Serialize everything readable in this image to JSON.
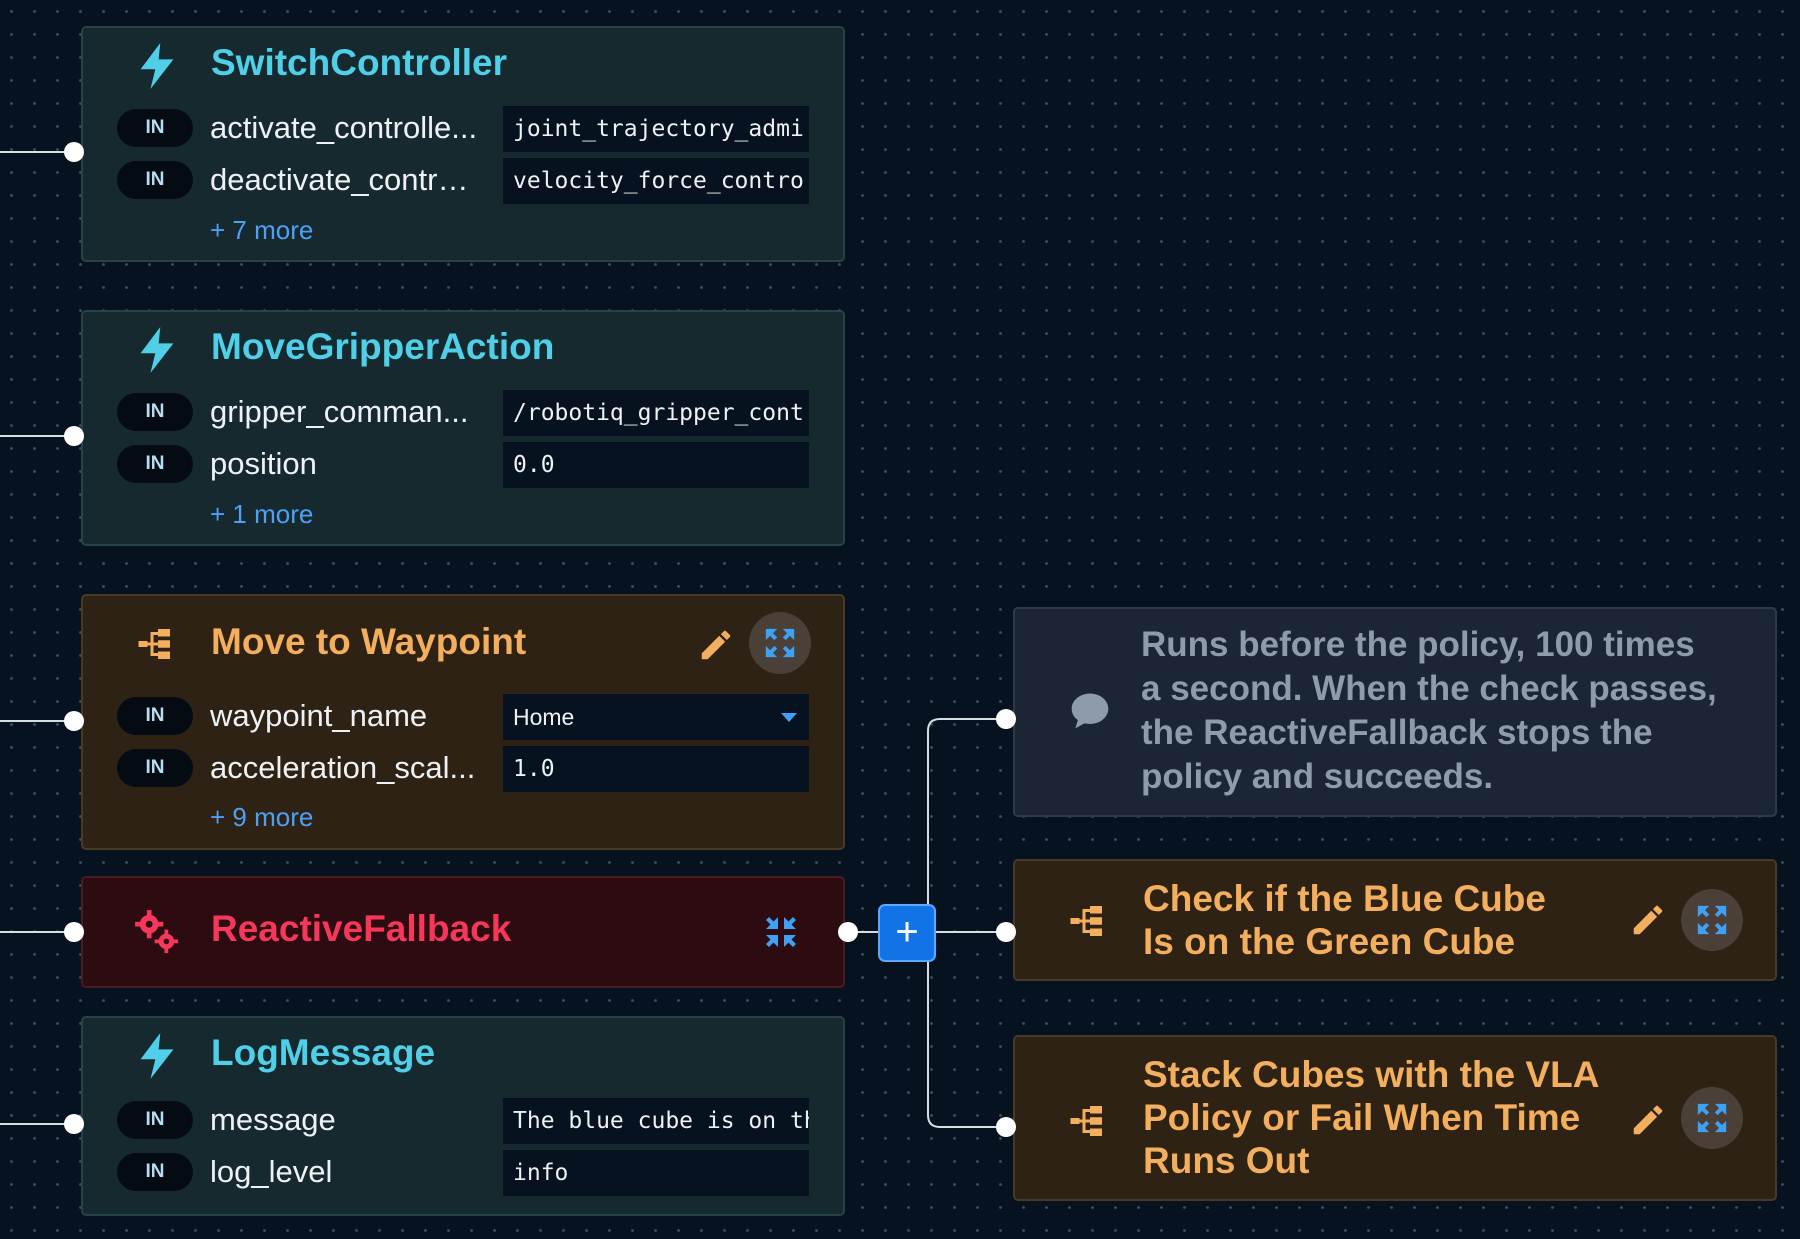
{
  "colors": {
    "canvas_bg": "#06121f",
    "action_title": "#4fd0e8",
    "subtree_title": "#f3ae5e",
    "control_title": "#f6375a",
    "link": "#4fa0f5",
    "add_button": "#1273e6"
  },
  "nodes": {
    "switch_controller": {
      "icon": "lightning-icon",
      "title": "SwitchController",
      "ports": [
        {
          "badge": "IN",
          "label": "activate_controlle...",
          "value": "joint_trajectory_admi"
        },
        {
          "badge": "IN",
          "label": "deactivate_contro...",
          "value": "velocity_force_contro"
        }
      ],
      "more": "+ 7 more"
    },
    "move_gripper_action": {
      "icon": "lightning-icon",
      "title": "MoveGripperAction",
      "ports": [
        {
          "badge": "IN",
          "label": "gripper_comman...",
          "value": "/robotiq_gripper_cont"
        },
        {
          "badge": "IN",
          "label": "position",
          "value": "0.0"
        }
      ],
      "more": "+ 1 more"
    },
    "move_to_waypoint": {
      "icon": "subtree-icon",
      "title": "Move to Waypoint",
      "ports": [
        {
          "badge": "IN",
          "label": "waypoint_name",
          "value": "Home",
          "dropdown": true
        },
        {
          "badge": "IN",
          "label": "acceleration_scal...",
          "value": "1.0"
        }
      ],
      "more": "+ 9 more"
    },
    "reactive_fallback": {
      "icon": "gears-icon",
      "title": "ReactiveFallback"
    },
    "log_message": {
      "icon": "lightning-icon",
      "title": "LogMessage",
      "ports": [
        {
          "badge": "IN",
          "label": "message",
          "value": "The blue cube is on th"
        },
        {
          "badge": "IN",
          "label": "log_level",
          "value": "info"
        }
      ]
    },
    "comment": {
      "icon": "comment-icon",
      "text": "Runs before the policy, 100 times a second. When the check passes, the ReactiveFallback stops the policy and succeeds."
    },
    "check_blue_cube": {
      "icon": "subtree-icon",
      "title": "Check if the Blue Cube Is on the Green Cube"
    },
    "stack_cubes": {
      "icon": "subtree-icon",
      "title": "Stack Cubes with the VLA Policy or Fail When Time Runs Out"
    }
  },
  "add_button_label": "+"
}
